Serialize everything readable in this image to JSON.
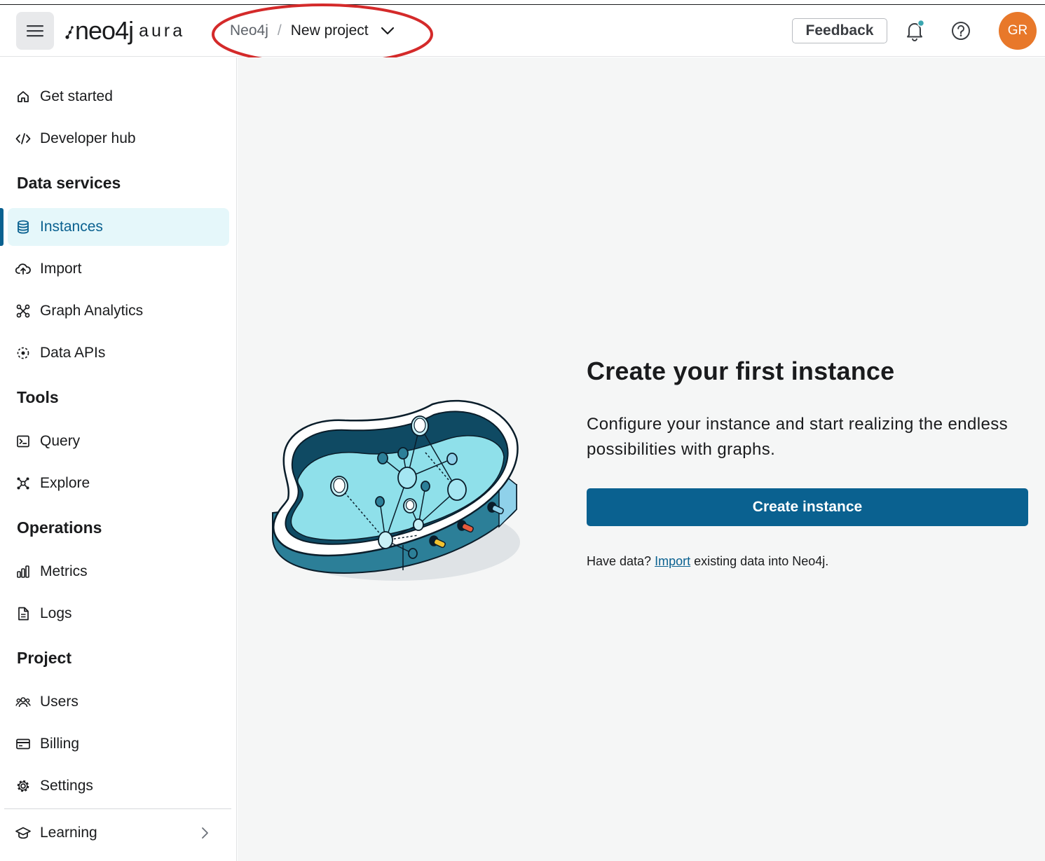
{
  "header": {
    "logo_main": "neo4j",
    "logo_sub": "aura",
    "breadcrumb": {
      "org": "Neo4j",
      "separator": "/",
      "project": "New project"
    },
    "feedback_label": "Feedback",
    "avatar_initials": "GR",
    "accent_color": "#0a6190",
    "avatar_color": "#e8782a",
    "annotation_color": "#d42a2a"
  },
  "sidebar": {
    "items": [
      {
        "label": "Get started",
        "icon": "home-icon"
      },
      {
        "label": "Developer hub",
        "icon": "code-icon"
      }
    ],
    "sections": [
      {
        "title": "Data services",
        "items": [
          {
            "label": "Instances",
            "icon": "database-icon",
            "active": true
          },
          {
            "label": "Import",
            "icon": "cloud-upload-icon"
          },
          {
            "label": "Graph Analytics",
            "icon": "graph-analytics-icon"
          },
          {
            "label": "Data APIs",
            "icon": "data-api-icon"
          }
        ]
      },
      {
        "title": "Tools",
        "items": [
          {
            "label": "Query",
            "icon": "terminal-icon"
          },
          {
            "label": "Explore",
            "icon": "explore-icon"
          }
        ]
      },
      {
        "title": "Operations",
        "items": [
          {
            "label": "Metrics",
            "icon": "bar-chart-icon"
          },
          {
            "label": "Logs",
            "icon": "document-icon"
          }
        ]
      },
      {
        "title": "Project",
        "items": [
          {
            "label": "Users",
            "icon": "users-icon"
          },
          {
            "label": "Billing",
            "icon": "credit-card-icon"
          },
          {
            "label": "Settings",
            "icon": "gear-icon"
          }
        ]
      }
    ],
    "learning_label": "Learning"
  },
  "main": {
    "title": "Create your first instance",
    "description": "Configure your instance and start realizing the endless possibilities with graphs.",
    "create_button": "Create instance",
    "import_prefix": "Have data?",
    "import_link": "Import",
    "import_suffix": "existing data into Neo4j."
  }
}
